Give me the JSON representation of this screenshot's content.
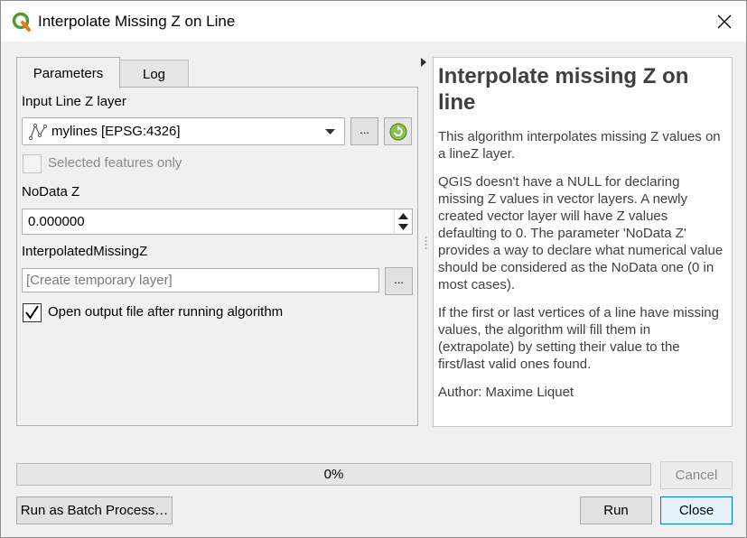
{
  "window": {
    "title": "Interpolate Missing Z on Line"
  },
  "tabs": [
    {
      "label": "Parameters",
      "active": true
    },
    {
      "label": "Log",
      "active": false
    }
  ],
  "params": {
    "input_layer_label": "Input Line Z layer",
    "input_layer_value": "mylines [EPSG:4326]",
    "browse_label": "...",
    "selected_only_label": "Selected features only",
    "nodata_label": "NoData Z",
    "nodata_value": "0.000000",
    "output_label": "InterpolatedMissingZ",
    "output_placeholder": "[Create temporary layer]",
    "open_output_label": "Open output file after running algorithm"
  },
  "help": {
    "title": "Interpolate missing Z on line",
    "paragraphs": [
      "This algorithm interpolates missing Z values on a lineZ layer.",
      "QGIS doesn't have a NULL for declaring missing Z values in vector layers. A newly created vector layer will have Z values defaulting to 0. The parameter 'NoData Z' provides a way to declare what numerical value should be considered as the NoData one (0 in most cases).",
      "If the first or last vertices of a line have missing values, the algorithm will fill them in (extrapolate) by setting their value to the first/last valid ones found.",
      "Author: Maxime Liquet"
    ]
  },
  "progress": {
    "value": 0,
    "text": "0%"
  },
  "buttons": {
    "cancel": "Cancel",
    "batch": "Run as Batch Process…",
    "run": "Run",
    "close": "Close"
  },
  "colors": {
    "qgis_green": "#589632",
    "qgis_yellow": "#ee7913",
    "accent": "#0078d7"
  }
}
